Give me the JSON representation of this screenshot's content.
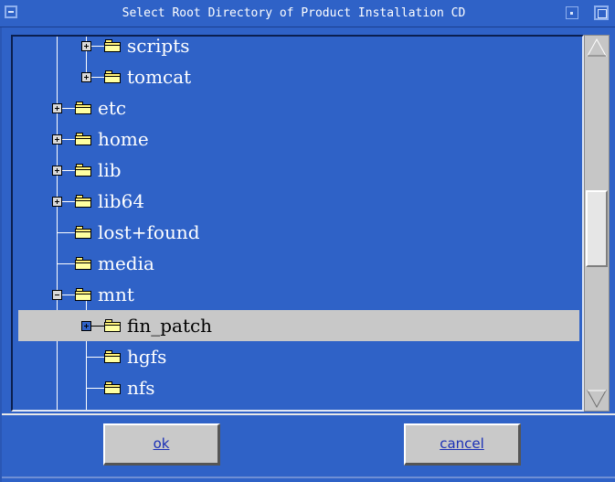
{
  "window": {
    "title": "Select Root Directory of Product Installation CD",
    "system_menu_icon": "window-menu-icon",
    "minimize_icon": "minimize-icon",
    "maximize_icon": "maximize-icon"
  },
  "tree": {
    "items": [
      {
        "label": "scripts",
        "depth": 2,
        "expander": "plus",
        "selected": false
      },
      {
        "label": "tomcat",
        "depth": 2,
        "expander": "plus",
        "selected": false
      },
      {
        "label": "etc",
        "depth": 1,
        "expander": "plus",
        "selected": false
      },
      {
        "label": "home",
        "depth": 1,
        "expander": "plus",
        "selected": false
      },
      {
        "label": "lib",
        "depth": 1,
        "expander": "plus",
        "selected": false
      },
      {
        "label": "lib64",
        "depth": 1,
        "expander": "plus",
        "selected": false
      },
      {
        "label": "lost+found",
        "depth": 1,
        "expander": "none",
        "selected": false
      },
      {
        "label": "media",
        "depth": 1,
        "expander": "none",
        "selected": false
      },
      {
        "label": "mnt",
        "depth": 1,
        "expander": "minus",
        "selected": false
      },
      {
        "label": "fin_patch",
        "depth": 2,
        "expander": "plus",
        "selected": true
      },
      {
        "label": "hgfs",
        "depth": 2,
        "expander": "none",
        "selected": false
      },
      {
        "label": "nfs",
        "depth": 2,
        "expander": "none",
        "selected": false
      }
    ],
    "icon": "folder-icon",
    "selection_color": "#c8c8c8",
    "background_color": "#2f62c7"
  },
  "buttons": {
    "ok_label": "ok",
    "cancel_label": "cancel"
  },
  "scrollbar": {
    "up_icon": "scroll-up-arrow-icon",
    "down_icon": "scroll-down-arrow-icon",
    "position_fraction": 0.52
  }
}
